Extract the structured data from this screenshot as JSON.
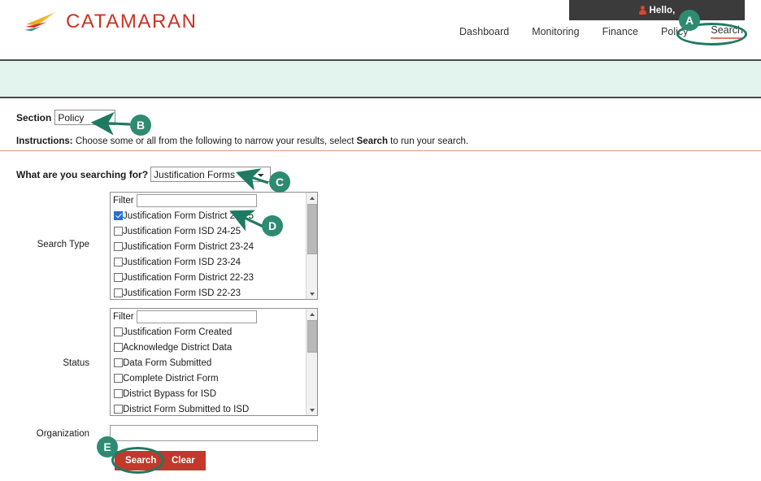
{
  "header": {
    "hello_text": "Hello,",
    "person_icon": "person-icon",
    "logo_text": "CATAMARAN",
    "logo_icon": "catamaran-sail-logo",
    "nav": [
      {
        "label": "Dashboard",
        "active": false
      },
      {
        "label": "Monitoring",
        "active": false
      },
      {
        "label": "Finance",
        "active": false
      },
      {
        "label": "Policy",
        "active": false
      },
      {
        "label": "Search",
        "active": true
      }
    ]
  },
  "form": {
    "section_label": "Section",
    "section_value": "Policy",
    "section_options": [
      "Policy"
    ],
    "instructions_prefix": "Instructions:",
    "instructions_part1": " Choose some or all from the following to narrow your results, select ",
    "instructions_bold": "Search",
    "instructions_part2": " to run your search.",
    "searching_for_label": "What are you searching for?",
    "searching_for_value": "Justification Forms",
    "searching_for_options": [
      "Justification Forms"
    ],
    "search_type": {
      "label": "Search Type",
      "filter_label": "Filter",
      "filter_value": "",
      "options": [
        {
          "label": "Justification Form District 24-25",
          "checked": true
        },
        {
          "label": "Justification Form ISD 24-25",
          "checked": false
        },
        {
          "label": "Justification Form District 23-24",
          "checked": false
        },
        {
          "label": "Justification Form ISD 23-24",
          "checked": false
        },
        {
          "label": "Justification Form District 22-23",
          "checked": false
        },
        {
          "label": "Justification Form ISD 22-23",
          "checked": false
        }
      ]
    },
    "status": {
      "label": "Status",
      "filter_label": "Filter",
      "filter_value": "",
      "options": [
        {
          "label": "Justification Form Created",
          "checked": false
        },
        {
          "label": "Acknowledge District Data",
          "checked": false
        },
        {
          "label": "Data Form Submitted",
          "checked": false
        },
        {
          "label": "Complete District Form",
          "checked": false
        },
        {
          "label": "District Bypass for ISD",
          "checked": false
        },
        {
          "label": "District Form Submitted to ISD",
          "checked": false
        }
      ]
    },
    "organization": {
      "label": "Organization",
      "value": "",
      "placeholder": ""
    },
    "search_button": "Search",
    "clear_button": "Clear"
  },
  "annotations": [
    {
      "letter": "A",
      "target": "nav-search"
    },
    {
      "letter": "B",
      "target": "section-select"
    },
    {
      "letter": "C",
      "target": "searching-for-select"
    },
    {
      "letter": "D",
      "target": "first-search-type-option"
    },
    {
      "letter": "E",
      "target": "search-button"
    }
  ],
  "colors": {
    "brand_red": "#cc3322",
    "button_red": "#c0392b",
    "annotation_green": "#2e8b72",
    "mint_banner": "#e3f4ee",
    "hello_bar": "#3b3b3b",
    "rule_salmon": "#e79a88",
    "checkbox_blue": "#2a6fd6"
  }
}
